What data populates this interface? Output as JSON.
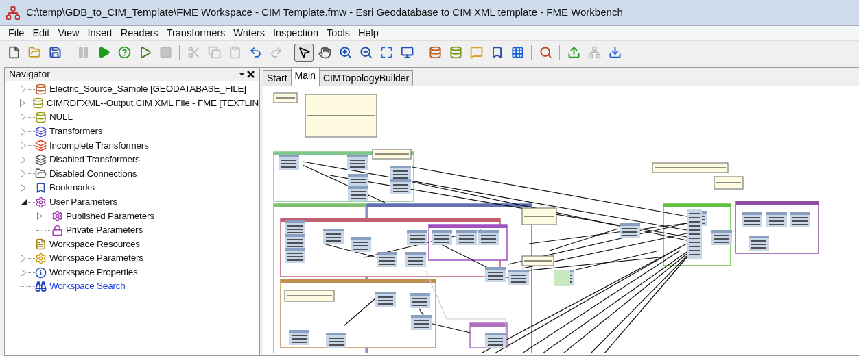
{
  "window": {
    "title": "C:\\temp\\GDB_to_CIM_Template\\FME Workspace - CIM Template.fmw - Esri Geodatabase to CIM XML template - FME Workbench"
  },
  "menu": [
    "File",
    "Edit",
    "View",
    "Insert",
    "Readers",
    "Transformers",
    "Writers",
    "Inspection",
    "Tools",
    "Help"
  ],
  "toolbar": [
    [
      {
        "kind": "new",
        "disabled": false,
        "selected": false
      },
      {
        "kind": "open",
        "disabled": false,
        "selected": false
      },
      {
        "kind": "save",
        "disabled": false,
        "selected": false
      }
    ],
    [
      {
        "kind": "pause",
        "disabled": true,
        "selected": false
      },
      {
        "kind": "run",
        "disabled": false,
        "selected": false
      },
      {
        "kind": "run-prompt",
        "disabled": false,
        "selected": false
      },
      {
        "kind": "run-partial",
        "disabled": false,
        "selected": false
      },
      {
        "kind": "stop",
        "disabled": true,
        "selected": false
      }
    ],
    [
      {
        "kind": "cut",
        "disabled": true,
        "selected": false
      },
      {
        "kind": "copy",
        "disabled": true,
        "selected": false
      },
      {
        "kind": "paste",
        "disabled": true,
        "selected": false
      },
      {
        "kind": "undo",
        "disabled": false,
        "selected": false
      },
      {
        "kind": "redo",
        "disabled": true,
        "selected": false
      }
    ],
    [
      {
        "kind": "select",
        "disabled": false,
        "selected": true
      },
      {
        "kind": "pan",
        "disabled": false,
        "selected": false
      },
      {
        "kind": "zoom-in",
        "disabled": false,
        "selected": false
      },
      {
        "kind": "zoom-out",
        "disabled": false,
        "selected": false
      },
      {
        "kind": "zoom-extents",
        "disabled": false,
        "selected": false
      },
      {
        "kind": "zoom-screen",
        "disabled": false,
        "selected": false
      }
    ],
    [
      {
        "kind": "add-reader",
        "disabled": false,
        "selected": false
      },
      {
        "kind": "add-writer",
        "disabled": false,
        "selected": false
      },
      {
        "kind": "annotation",
        "disabled": false,
        "selected": false
      },
      {
        "kind": "bookmark",
        "disabled": false,
        "selected": false
      },
      {
        "kind": "grid",
        "disabled": false,
        "selected": false
      }
    ],
    [
      {
        "kind": "inspect",
        "disabled": false,
        "selected": false
      }
    ],
    [
      {
        "kind": "upload",
        "disabled": false,
        "selected": false
      },
      {
        "kind": "server",
        "disabled": true,
        "selected": false
      },
      {
        "kind": "download",
        "disabled": false,
        "selected": false
      }
    ]
  ],
  "navigator": {
    "title": "Navigator",
    "items": [
      {
        "label": "Electric_Source_Sample [GEODATABASE_FILE]",
        "kind": "reader",
        "expanded": false
      },
      {
        "label": "CIMRDFXML--Output CIM XML File - FME [TEXTLIN",
        "kind": "writer",
        "expanded": false
      },
      {
        "label": "NULL",
        "kind": "writer",
        "expanded": false
      },
      {
        "label": "Transformers",
        "kind": "transformers",
        "expanded": false
      },
      {
        "label": "Incomplete Transformers",
        "kind": "incomplete",
        "expanded": false
      },
      {
        "label": "Disabled Transformers",
        "kind": "disabled",
        "expanded": false
      },
      {
        "label": "Disabled Connections",
        "kind": "connections",
        "expanded": false
      },
      {
        "label": "Bookmarks",
        "kind": "bookmarks",
        "expanded": false
      },
      {
        "label": "User Parameters",
        "kind": "user-params",
        "expanded": true,
        "children": [
          {
            "label": "Published Parameters",
            "kind": "user-params",
            "expanded": false
          },
          {
            "label": "Private Parameters",
            "kind": "private-params"
          }
        ]
      },
      {
        "label": "Workspace Resources",
        "kind": "resources"
      },
      {
        "label": "Workspace Parameters",
        "kind": "ws-params",
        "expanded": false
      },
      {
        "label": "Workspace Properties",
        "kind": "properties",
        "expanded": false
      },
      {
        "label": "Workspace Search",
        "kind": "search-link"
      }
    ]
  },
  "tabs": [
    {
      "label": "Start",
      "selected": false
    },
    {
      "label": "Main",
      "selected": true
    },
    {
      "label": "CIMTopologyBuilder",
      "selected": false
    }
  ]
}
